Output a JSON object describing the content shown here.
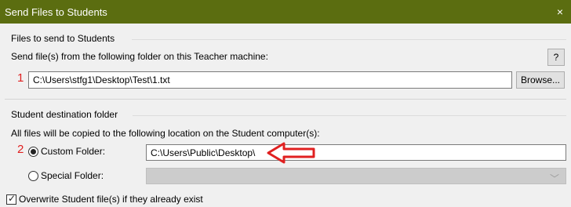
{
  "window": {
    "title": "Send Files to Students",
    "close_glyph": "×"
  },
  "files_group": {
    "title": "Files to send to Students",
    "description": "Send file(s) from the following folder on this Teacher machine:",
    "help_label": "?",
    "marker": "1",
    "path_value": "C:\\Users\\stfg1\\Desktop\\Test\\1.txt",
    "browse_label": "Browse..."
  },
  "destination_group": {
    "title": "Student destination folder",
    "description": "All files will be copied to the following location on the Student computer(s):",
    "marker": "2",
    "custom_folder_label": "Custom Folder:",
    "custom_folder_value": "C:\\Users\\Public\\Desktop\\",
    "custom_selected": true,
    "special_folder_label": "Special Folder:",
    "special_folder_value": "",
    "overwrite_label": "Overwrite Student file(s) if they already exist",
    "overwrite_checked": true
  },
  "annotation": {
    "arrow_color": "#e02020",
    "arrow_icon": "left-arrow-outline-icon"
  },
  "colors": {
    "titlebar": "#5b6d10",
    "dialog_bg": "#f0f0f0"
  }
}
